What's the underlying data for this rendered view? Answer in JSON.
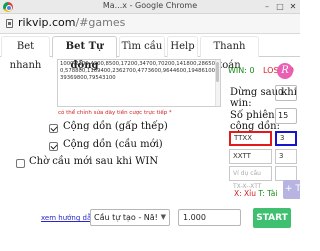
{
  "window": {
    "title": "Ma...x - Google Chrome",
    "controls": {
      "minimize": "–",
      "maximize": "□",
      "close": "✕"
    }
  },
  "address_bar": {
    "host": "rikvip.com",
    "path": "/#games"
  },
  "tabs": [
    {
      "label": "Bet nhanh",
      "active": false
    },
    {
      "label": "Bet Tự động",
      "active": true
    },
    {
      "label": "Tìm cầu",
      "active": false
    },
    {
      "label": "Help",
      "active": false
    },
    {
      "label": "Thanh toán",
      "active": false
    }
  ],
  "bet_list": {
    "value": "1000,2100,4200,8500,17200,34700,70200,141800,286500,578800,1169400,2362700,4773600,9644600,19486100,39369800,79543100"
  },
  "hint": "có thể chỉnh sửa dãy tiền cược trực tiếp *",
  "options": [
    {
      "label": "Cộng dồn (gấp thếp)",
      "checked": true
    },
    {
      "label": "Cộng dồn (cầu mới)",
      "checked": true
    },
    {
      "label": "Chờ cầu mới sau khi WIN",
      "checked": false
    }
  ],
  "stats": {
    "win_label": "WIN: 0",
    "lose_label": "LOSE: 0",
    "logo_char": "R"
  },
  "stop_after_win": {
    "label": "Dừng sau khi win:",
    "value": "0"
  },
  "rounds": {
    "label": "Số phiên cộng dồn:",
    "value": "15"
  },
  "patterns": [
    {
      "pattern": "TTXX",
      "count": "3",
      "placeholder": ""
    },
    {
      "pattern": "XXTT",
      "count": "3",
      "placeholder": ""
    },
    {
      "pattern": "",
      "count": "",
      "placeholder": "Ví dụ cầu TX-X--XTT"
    }
  ],
  "legend": {
    "x_label": "X: Xỉu",
    "t_label": "T: Tài"
  },
  "add_pattern_button": "+ THÊM CẦU",
  "guide_link": "xem hướng dẫn",
  "strategy_select": {
    "value": "Cầu tự tạo - Nă!"
  },
  "amount_input": {
    "value": "1.000"
  },
  "start_button": "START",
  "colors": {
    "win": "#168d16",
    "lose": "#d81f1f",
    "highlight_pattern": "#e21a1a",
    "highlight_count": "#1515cc",
    "start": "#3fbf70",
    "add": "#b7b4e2",
    "link": "#2929c9"
  }
}
